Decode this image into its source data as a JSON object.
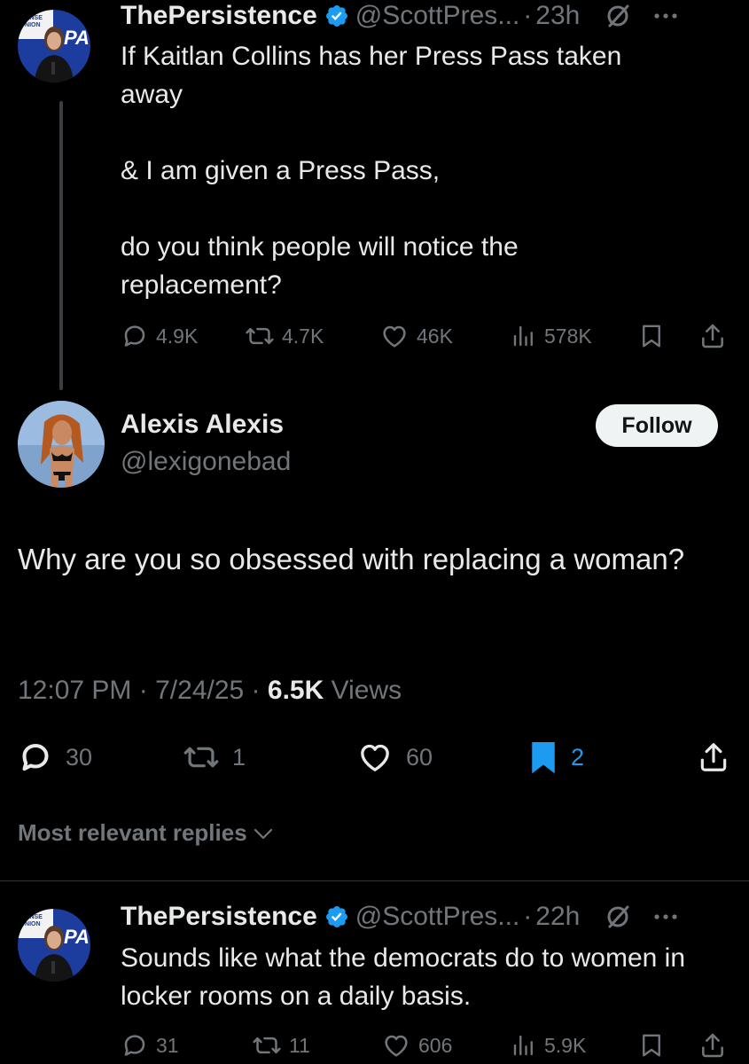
{
  "parent_tweet": {
    "display_name": "ThePersistence",
    "handle": "@ScottPres...",
    "separator": "·",
    "time": "23h",
    "text_lines": [
      "If Kaitlan Collins has her Press Pass taken away",
      "& I am given a Press Pass,",
      "do you think people will notice the replacement?"
    ],
    "replies": "4.9K",
    "reposts": "4.7K",
    "likes": "46K",
    "views": "578K",
    "avatar_sign_text": "AMERICAN CONSERVATIVE UNION"
  },
  "main_tweet": {
    "display_name": "Alexis Alexis",
    "handle": "@lexigonebad",
    "follow_label": "Follow",
    "text": "Why are you so obsessed with replacing a woman?",
    "time": "12:07 PM",
    "date": "7/24/25",
    "separator": "·",
    "views_count": "6.5K",
    "views_label": "Views",
    "replies": "30",
    "reposts": "1",
    "likes": "60",
    "bookmarks": "2"
  },
  "sort": {
    "label": "Most relevant replies"
  },
  "reply_tweet": {
    "display_name": "ThePersistence",
    "handle": "@ScottPres...",
    "separator": "·",
    "time": "22h",
    "text": "Sounds like what the democrats do to women in locker rooms on a daily basis.",
    "replies": "31",
    "reposts": "11",
    "likes": "606",
    "views": "5.9K"
  },
  "colors": {
    "background": "#000000",
    "text_primary": "#e7e9ea",
    "text_secondary": "#71767b",
    "accent_blue": "#1d9bf0",
    "follow_bg": "#eff3f4"
  },
  "icons": [
    "verified-badge-icon",
    "grok-icon",
    "more-icon",
    "reply-icon",
    "repost-icon",
    "like-icon",
    "views-icon",
    "bookmark-icon",
    "share-icon",
    "chevron-down-icon"
  ]
}
